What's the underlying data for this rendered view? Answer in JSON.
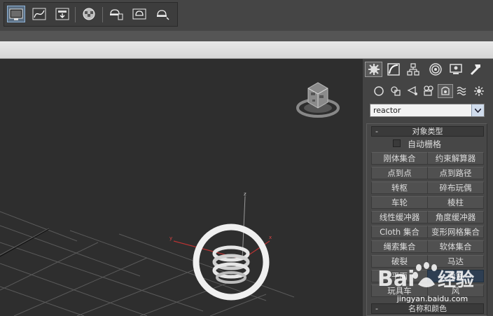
{
  "toolbar": {
    "buttons": [
      {
        "icon": "scene-explorer-icon",
        "active": true
      },
      {
        "icon": "curve-editor-icon"
      },
      {
        "icon": "schematic-view-icon"
      },
      {
        "icon": "material-editor-icon"
      },
      {
        "icon": "render-setup-icon"
      },
      {
        "icon": "rendered-frame-window-icon"
      },
      {
        "icon": "quick-render-icon"
      }
    ]
  },
  "viewport": {
    "axis_x": "x",
    "axis_y": "y",
    "axis_z": "z"
  },
  "command_panel": {
    "tabs": [
      "create-tab-icon",
      "modify-tab-icon",
      "hierarchy-tab-icon",
      "motion-tab-icon",
      "display-tab-icon",
      "utilities-tab-icon"
    ],
    "subtabs": [
      "geometry-icon",
      "shapes-icon",
      "lights-icon",
      "cameras-icon",
      "helpers-icon",
      "space-warps-icon",
      "systems-icon"
    ],
    "category_dropdown": "reactor",
    "object_type": {
      "title": "对象类型",
      "collapse": "-",
      "autogrid_label": "自动栅格",
      "buttons": [
        "刚体集合",
        "约束解算器",
        "点到点",
        "点到路径",
        "转枢",
        "碎布玩偶",
        "车轮",
        "棱柱",
        "线性缓冲器",
        "角度缓冲器",
        "Cloth 集合",
        "变形网格集合",
        "绳索集合",
        "软体集合",
        "破裂",
        "马达",
        "平面",
        "弹簧",
        "玩具车",
        "风"
      ],
      "active_button": "弹簧"
    },
    "name_color": {
      "title": "名称和颜色",
      "collapse": "-"
    }
  },
  "watermark": {
    "brand": "Baidu经验",
    "url": "jingyan.baidu.com"
  }
}
